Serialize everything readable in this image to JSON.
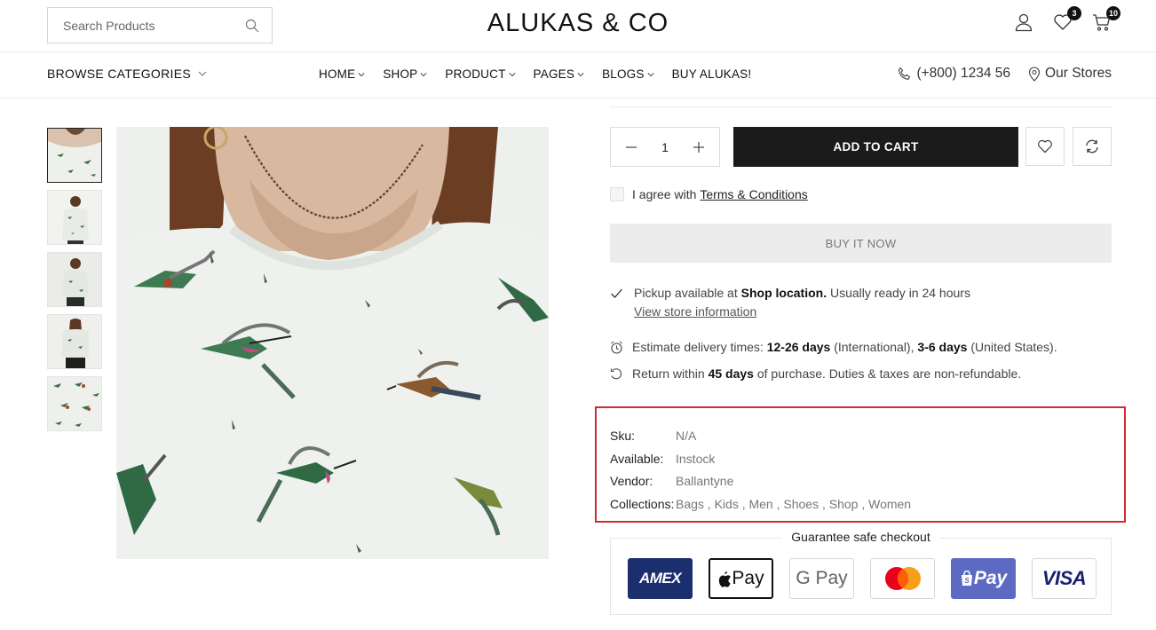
{
  "header": {
    "search_placeholder": "Search Products",
    "logo": "ALUKAS & CO",
    "wishlist_count": "3",
    "cart_count": "10"
  },
  "nav": {
    "browse": "BROWSE CATEGORIES",
    "items": [
      {
        "label": "HOME",
        "has_dropdown": true
      },
      {
        "label": "SHOP",
        "has_dropdown": true
      },
      {
        "label": "PRODUCT",
        "has_dropdown": true
      },
      {
        "label": "PAGES",
        "has_dropdown": true
      },
      {
        "label": "BLOGS",
        "has_dropdown": true
      },
      {
        "label": "BUY ALUKAS!",
        "has_dropdown": false
      }
    ],
    "phone": "(+800) 1234 56",
    "stores": "Our Stores"
  },
  "product": {
    "quantity": "1",
    "add_to_cart": "ADD TO CART",
    "agree_prefix": "I agree with",
    "terms_link": "Terms & Conditions",
    "buy_now": "BUY IT NOW",
    "pickup_prefix": "Pickup available at",
    "pickup_location": "Shop location.",
    "pickup_suffix": "Usually ready in 24 hours",
    "view_store": "View store information",
    "delivery_prefix": "Estimate delivery times:",
    "delivery_intl": "12-26 days",
    "delivery_intl_note": "(International),",
    "delivery_us": "3-6 days",
    "delivery_us_note": "(United States).",
    "return_prefix": "Return within",
    "return_days": "45 days",
    "return_suffix": "of purchase. Duties & taxes are non-refundable."
  },
  "meta": {
    "sku_label": "Sku:",
    "sku": "N/A",
    "available_label": "Available:",
    "available": "Instock",
    "vendor_label": "Vendor:",
    "vendor": "Ballantyne",
    "collections_label": "Collections:",
    "collections": "Bags , Kids , Men , Shoes , Shop , Women"
  },
  "checkout": {
    "title": "Guarantee safe checkout",
    "methods": [
      "AMEX",
      "Pay",
      "G Pay",
      "",
      "Pay",
      "VISA"
    ]
  },
  "colors": {
    "highlight": "#d12a32",
    "dark_button": "#1b1b1b"
  }
}
